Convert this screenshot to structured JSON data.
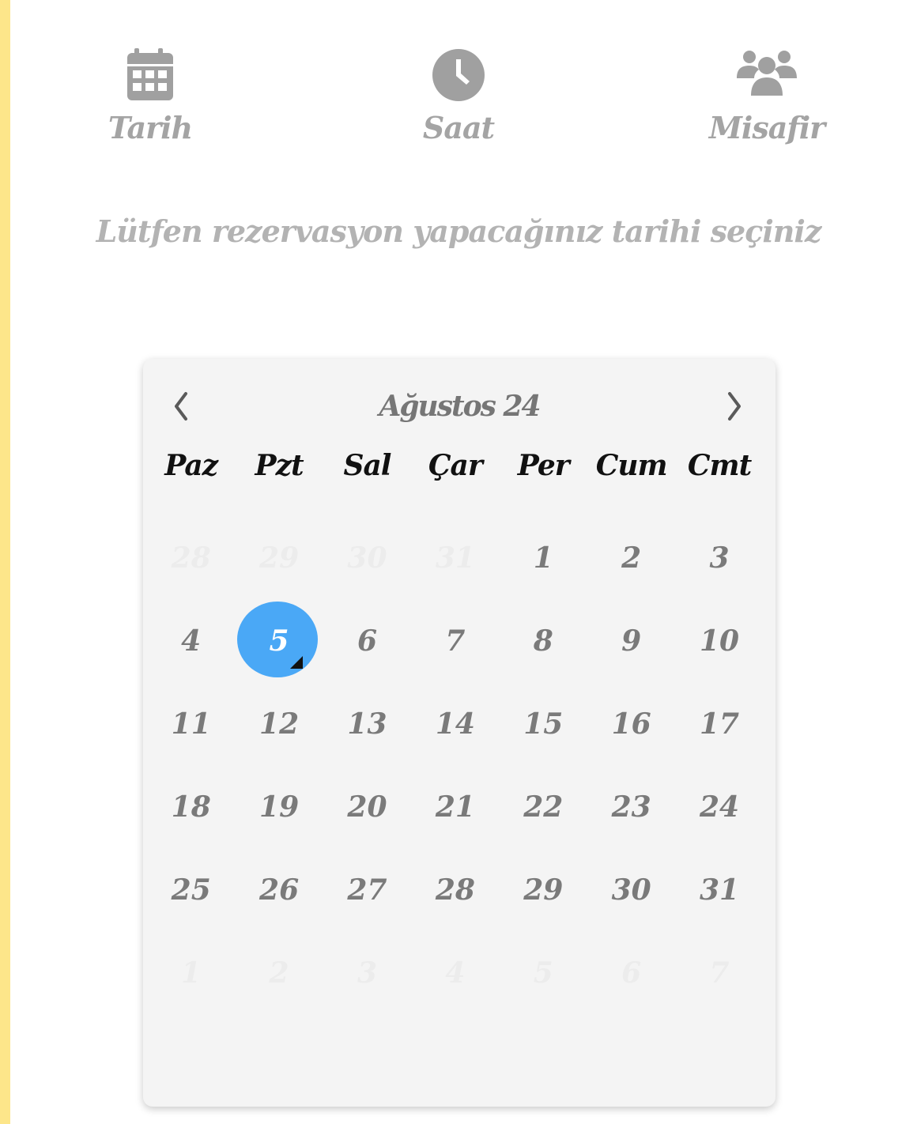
{
  "colors": {
    "side_bar": "#fde68a",
    "icon": "#a0a0a0",
    "selected_day": "#4aa8f6"
  },
  "steps": [
    {
      "label": "Tarih",
      "icon": "calendar-icon"
    },
    {
      "label": "Saat",
      "icon": "clock-icon"
    },
    {
      "label": "Misafir",
      "icon": "users-icon"
    }
  ],
  "prompt": "Lütfen rezervasyon yapacağınız tarihi seçiniz",
  "calendar": {
    "month_label": "Ağustos 24",
    "prev_icon": "chevron-left-icon",
    "next_icon": "chevron-right-icon",
    "weekdays": [
      "Paz",
      "Pzt",
      "Sal",
      "Çar",
      "Per",
      "Cum",
      "Cmt"
    ],
    "selected_day": "5",
    "weeks": [
      [
        {
          "d": "28",
          "muted": true
        },
        {
          "d": "29",
          "muted": true
        },
        {
          "d": "30",
          "muted": true
        },
        {
          "d": "31",
          "muted": true
        },
        {
          "d": "1"
        },
        {
          "d": "2"
        },
        {
          "d": "3"
        }
      ],
      [
        {
          "d": "4"
        },
        {
          "d": "5",
          "selected": true
        },
        {
          "d": "6"
        },
        {
          "d": "7"
        },
        {
          "d": "8"
        },
        {
          "d": "9"
        },
        {
          "d": "10"
        }
      ],
      [
        {
          "d": "11"
        },
        {
          "d": "12"
        },
        {
          "d": "13"
        },
        {
          "d": "14"
        },
        {
          "d": "15"
        },
        {
          "d": "16"
        },
        {
          "d": "17"
        }
      ],
      [
        {
          "d": "18"
        },
        {
          "d": "19"
        },
        {
          "d": "20"
        },
        {
          "d": "21"
        },
        {
          "d": "22"
        },
        {
          "d": "23"
        },
        {
          "d": "24"
        }
      ],
      [
        {
          "d": "25"
        },
        {
          "d": "26"
        },
        {
          "d": "27"
        },
        {
          "d": "28"
        },
        {
          "d": "29"
        },
        {
          "d": "30"
        },
        {
          "d": "31"
        }
      ],
      [
        {
          "d": "1",
          "muted": true
        },
        {
          "d": "2",
          "muted": true
        },
        {
          "d": "3",
          "muted": true
        },
        {
          "d": "4",
          "muted": true
        },
        {
          "d": "5",
          "muted": true
        },
        {
          "d": "6",
          "muted": true
        },
        {
          "d": "7",
          "muted": true
        }
      ]
    ]
  }
}
